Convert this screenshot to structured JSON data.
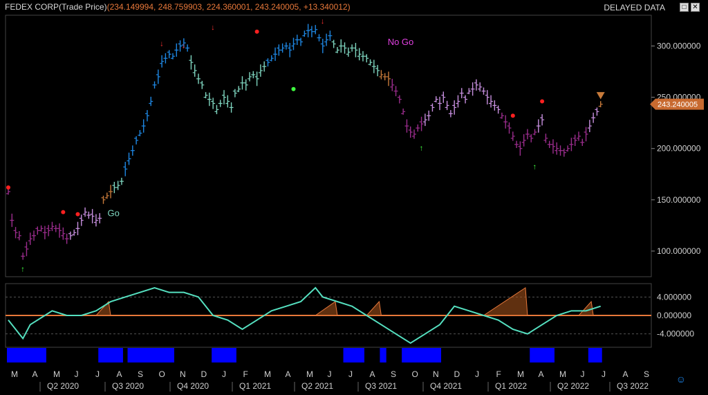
{
  "header": {
    "symbol": "FEDEX CORP(Trade Price)",
    "values": "(234.149994, 248.759903, 224.360001, 243.240005, +13.340012)",
    "delayed": "DELAYED DATA"
  },
  "window": {
    "maximize_icon": "maximize-icon",
    "close_icon": "close-icon",
    "max_glyph": "□",
    "close_glyph": "✕"
  },
  "footer": {
    "smiley_icon": "smiley-icon",
    "smiley_glyph": "☺"
  },
  "colors": {
    "go_strong": "#1e88e5",
    "go_weak": "#7fd6c0",
    "nogo_weak": "#c890e0",
    "nogo_strong": "#9c2d8e",
    "neutral": "#c77a3a",
    "oscillator": "#55e0c0",
    "zero_line": "#e8783a",
    "volume": "#0000ff",
    "last_tag": "#c86a30"
  },
  "chart_data": [
    {
      "type": "ohlc",
      "title": "FEDEX CORP(Trade Price)",
      "ylim": [
        75,
        330
      ],
      "yticks": [
        "300.000000",
        "250.000000",
        "200.000000",
        "150.000000",
        "100.000000"
      ],
      "last_price_label": "243.240005",
      "annotations": [
        "Go",
        "No Go"
      ],
      "series": [
        {
          "name": "strong_nogo",
          "x": [
            0,
            1,
            2,
            3,
            4,
            5,
            6,
            7,
            8,
            9,
            10,
            11,
            12,
            13,
            14,
            15,
            16
          ],
          "y": [
            158,
            130,
            118,
            115,
            95,
            102,
            112,
            115,
            120,
            122,
            118,
            120,
            124,
            122,
            120,
            117,
            112
          ]
        },
        {
          "name": "weak_nogo",
          "x": [
            17,
            18,
            19,
            20,
            21,
            22,
            23,
            24,
            25
          ],
          "y": [
            115,
            118,
            122,
            130,
            138,
            135,
            134,
            130,
            132
          ]
        },
        {
          "name": "neutral",
          "x": [
            26,
            27,
            28
          ],
          "y": [
            150,
            154,
            158
          ]
        },
        {
          "name": "weak_go",
          "x": [
            29,
            30,
            31
          ],
          "y": [
            162,
            164,
            168
          ]
        },
        {
          "name": "strong_go",
          "x": [
            32,
            33,
            34,
            35,
            36,
            37,
            38,
            39,
            40,
            41,
            42,
            43,
            44,
            45,
            46,
            47,
            48,
            49
          ],
          "y": [
            180,
            190,
            198,
            208,
            215,
            222,
            232,
            246,
            262,
            270,
            285,
            288,
            292,
            290,
            296,
            300,
            303,
            298
          ]
        },
        {
          "name": "weak_go",
          "x": [
            50,
            51,
            52,
            53,
            54,
            55,
            56,
            57,
            58,
            59,
            60,
            61,
            62,
            63,
            64,
            65,
            66,
            67,
            68,
            69,
            70
          ],
          "y": [
            284,
            276,
            268,
            262,
            252,
            248,
            244,
            238,
            244,
            250,
            246,
            240,
            254,
            258,
            264,
            262,
            270,
            272,
            268,
            276,
            280
          ]
        },
        {
          "name": "strong_go",
          "x": [
            71,
            72,
            73,
            74,
            75,
            76,
            77,
            78,
            79,
            80,
            81,
            82,
            83,
            84,
            85,
            86,
            87,
            88
          ],
          "y": [
            284,
            288,
            292,
            296,
            298,
            300,
            296,
            302,
            306,
            304,
            312,
            315,
            314,
            316,
            308,
            300,
            306,
            310
          ]
        },
        {
          "name": "weak_go",
          "x": [
            89,
            90,
            91,
            92,
            93,
            94,
            95,
            96,
            97,
            98,
            99,
            100,
            101
          ],
          "y": [
            302,
            296,
            300,
            298,
            294,
            298,
            296,
            292,
            290,
            288,
            284,
            280,
            276
          ]
        },
        {
          "name": "neutral",
          "x": [
            102,
            103,
            104
          ],
          "y": [
            272,
            270,
            268
          ]
        },
        {
          "name": "strong_nogo",
          "x": [
            105,
            106,
            107,
            108,
            109,
            110,
            111,
            112,
            113
          ],
          "y": [
            262,
            256,
            248,
            236,
            222,
            216,
            214,
            220,
            224
          ]
        },
        {
          "name": "weak_nogo",
          "x": [
            114,
            115,
            116,
            117,
            118,
            119,
            120,
            121,
            122,
            123,
            124,
            125,
            126,
            127,
            128,
            129,
            130,
            131,
            132,
            133,
            134
          ],
          "y": [
            228,
            232,
            240,
            248,
            244,
            250,
            242,
            234,
            240,
            246,
            254,
            248,
            256,
            258,
            262,
            260,
            256,
            250,
            246,
            242,
            238
          ]
        },
        {
          "name": "strong_nogo",
          "x": [
            135,
            136,
            137,
            138,
            139,
            140,
            141,
            142,
            143,
            144
          ],
          "y": [
            232,
            226,
            220,
            212,
            204,
            200,
            208,
            214,
            210,
            216
          ]
        },
        {
          "name": "weak_nogo",
          "x": [
            145,
            146
          ],
          "y": [
            222,
            228
          ]
        },
        {
          "name": "strong_nogo",
          "x": [
            147,
            148,
            149,
            150,
            151,
            152,
            153,
            154,
            155,
            156,
            157,
            158
          ],
          "y": [
            210,
            204,
            202,
            200,
            198,
            196,
            200,
            204,
            208,
            212,
            206,
            214
          ]
        },
        {
          "name": "weak_nogo",
          "x": [
            159,
            160,
            161
          ],
          "y": [
            222,
            230,
            236
          ]
        },
        {
          "name": "neutral",
          "x": [
            162
          ],
          "y": [
            243.24
          ]
        }
      ]
    },
    {
      "type": "oscillator",
      "ylim": [
        -6,
        6
      ],
      "yticks": [
        "4.000000",
        "0.000000",
        "-4.000000"
      ],
      "x": [
        0,
        4,
        6,
        10,
        12,
        16,
        20,
        24,
        28,
        32,
        36,
        40,
        44,
        48,
        52,
        56,
        60,
        64,
        68,
        72,
        76,
        80,
        84,
        86,
        90,
        94,
        98,
        102,
        106,
        110,
        114,
        118,
        122,
        126,
        130,
        134,
        138,
        142,
        146,
        150,
        154,
        158,
        162
      ],
      "values": [
        -1,
        -5,
        -2,
        0,
        1,
        0,
        0,
        1,
        3,
        4,
        5,
        6,
        5,
        5,
        4,
        0,
        -1,
        -3,
        -1,
        1,
        2,
        3,
        6,
        4,
        3,
        2,
        0,
        -2,
        -4,
        -6,
        -4,
        -2,
        2,
        1,
        0,
        -1,
        -3,
        -4,
        -2,
        0,
        1,
        1,
        2
      ]
    },
    {
      "type": "bar",
      "title": "",
      "note": "blue regime bars",
      "spans": [
        [
          0,
          10
        ],
        [
          25,
          31
        ],
        [
          33,
          45
        ],
        [
          56,
          62
        ],
        [
          92,
          97
        ],
        [
          102,
          103
        ],
        [
          108,
          118
        ],
        [
          143,
          149
        ],
        [
          159,
          162
        ]
      ]
    }
  ],
  "x_axis": {
    "months": [
      "M",
      "A",
      "M",
      "J",
      "J",
      "A",
      "S",
      "O",
      "N",
      "D",
      "J",
      "F",
      "M",
      "A",
      "M",
      "J",
      "J",
      "A",
      "S",
      "O",
      "N",
      "D",
      "J",
      "F",
      "M",
      "A",
      "M",
      "J",
      "J",
      "A",
      "S"
    ],
    "quarters": [
      "Q2 2020",
      "Q3 2020",
      "Q4 2020",
      "Q1 2021",
      "Q2 2021",
      "Q3 2021",
      "Q4 2021",
      "Q1 2022",
      "Q2 2022",
      "Q3 2022"
    ]
  }
}
